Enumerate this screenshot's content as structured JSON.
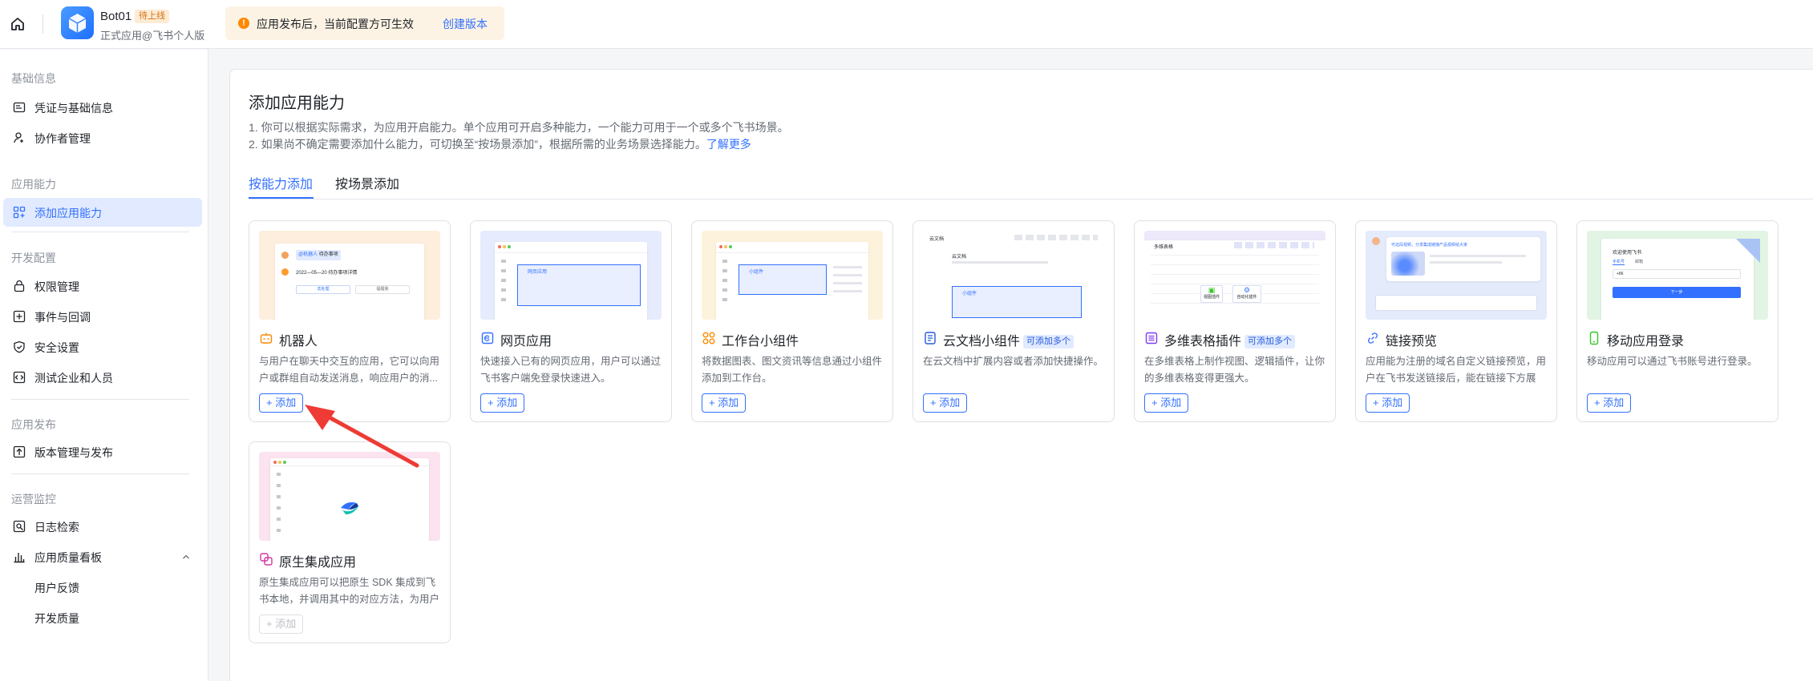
{
  "header": {
    "app_name": "Bot01",
    "status_badge": "待上线",
    "app_subtitle": "正式应用@飞书个人版",
    "notice_text": "应用发布后，当前配置方可生效",
    "notice_link": "创建版本"
  },
  "sidebar": {
    "sections": [
      {
        "title": "基础信息",
        "items": [
          {
            "label": "凭证与基础信息",
            "icon": "id-card-icon"
          },
          {
            "label": "协作者管理",
            "icon": "user-add-icon"
          }
        ]
      },
      {
        "title": "应用能力",
        "items": [
          {
            "label": "添加应用能力",
            "icon": "app-grid-icon"
          }
        ]
      },
      {
        "title": "开发配置",
        "items": [
          {
            "label": "权限管理",
            "icon": "lock-icon"
          },
          {
            "label": "事件与回调",
            "icon": "event-icon"
          },
          {
            "label": "安全设置",
            "icon": "shield-icon"
          },
          {
            "label": "测试企业和人员",
            "icon": "code-icon"
          }
        ]
      },
      {
        "title": "应用发布",
        "items": [
          {
            "label": "版本管理与发布",
            "icon": "upload-icon"
          }
        ]
      },
      {
        "title": "运营监控",
        "items": [
          {
            "label": "日志检索",
            "icon": "log-search-icon"
          },
          {
            "label": "应用质量看板",
            "icon": "bar-chart-icon"
          },
          {
            "label": "用户反馈"
          },
          {
            "label": "开发质量"
          }
        ]
      }
    ],
    "active": "添加应用能力"
  },
  "main": {
    "title": "添加应用能力",
    "desc_line1": "1. 你可以根据实际需求，为应用开启能力。单个应用可开启多种能力，一个能力可用于一个或多个飞书场景。",
    "desc_line2": "2. 如果尚不确定需要添加什么能力，可切换至“按场景添加”，根据所需的业务场景选择能力。",
    "learn_more": "了解更多",
    "tabs": [
      {
        "label": "按能力添加"
      },
      {
        "label": "按场景添加"
      }
    ],
    "active_tab": "按能力添加",
    "add_label": "+ 添加",
    "cards": [
      {
        "title": "机器人",
        "tag": "",
        "desc": "与用户在聊天中交互的应用，它可以向用户或群组自动发送消息，响应用户的消...",
        "icon": "robot-icon",
        "bg": "#fdeedd",
        "add_enabled": true
      },
      {
        "title": "网页应用",
        "tag": "",
        "desc": "快速接入已有的网页应用，用户可以通过飞书客户端免登录快速进入。",
        "icon": "web-app-icon",
        "bg": "#e6ecfd",
        "add_enabled": true
      },
      {
        "title": "工作台小组件",
        "tag": "",
        "desc": "将数据图表、图文资讯等信息通过小组件添加到工作台。",
        "icon": "widget-icon",
        "bg": "#fdf3dc",
        "add_enabled": true
      },
      {
        "title": "云文档小组件",
        "tag": "可添加多个",
        "desc": "在云文档中扩展内容或者添加快捷操作。",
        "icon": "doc-widget-icon",
        "bg": "#e5e8f9",
        "add_enabled": true
      },
      {
        "title": "多维表格插件",
        "tag": "可添加多个",
        "desc": "在多维表格上制作视图、逻辑插件，让你的多维表格变得更强大。",
        "icon": "bitable-icon",
        "bg": "#eee8fb",
        "add_enabled": true
      },
      {
        "title": "链接预览",
        "tag": "",
        "desc": "应用能为注册的域名自定义链接预览，用户在飞书发送链接后，能在链接下方展示...",
        "icon": "link-icon",
        "bg": "#e4ebfb",
        "add_enabled": true
      },
      {
        "title": "移动应用登录",
        "tag": "",
        "desc": "移动应用可以通过飞书账号进行登录。",
        "icon": "mobile-icon",
        "bg": "#e2f4e4",
        "add_enabled": true
      },
      {
        "title": "原生集成应用",
        "tag": "",
        "desc": "原生集成应用可以把原生 SDK 集成到飞书本地，并调用其中的对应方法，为用户提...",
        "icon": "native-app-icon",
        "bg": "#fbe3ef",
        "add_enabled": false
      }
    ]
  },
  "mock_text": {
    "robot_chip1": "@机器人",
    "robot_chip2": "待办事项",
    "robot_line": "2022—05—20 待办事项详情",
    "robot_btn1": "去处理",
    "robot_btn2": "提醒我",
    "web_label": "网页应用",
    "widget_label": "小组件",
    "doc_header": "云文档",
    "doc_label": "小组件",
    "bitable_header": "多维表格",
    "bitable_btn1": "视图插件",
    "bitable_btn2": "自动化插件",
    "mobile_title": "欢迎使用飞书",
    "mobile_tab1": "手机号",
    "mobile_tab2": "邮箱",
    "mobile_prefix": "+86",
    "mobile_btn": "下一步",
    "link_text": "可这段视频，分享集成链接产品视频给大家"
  }
}
